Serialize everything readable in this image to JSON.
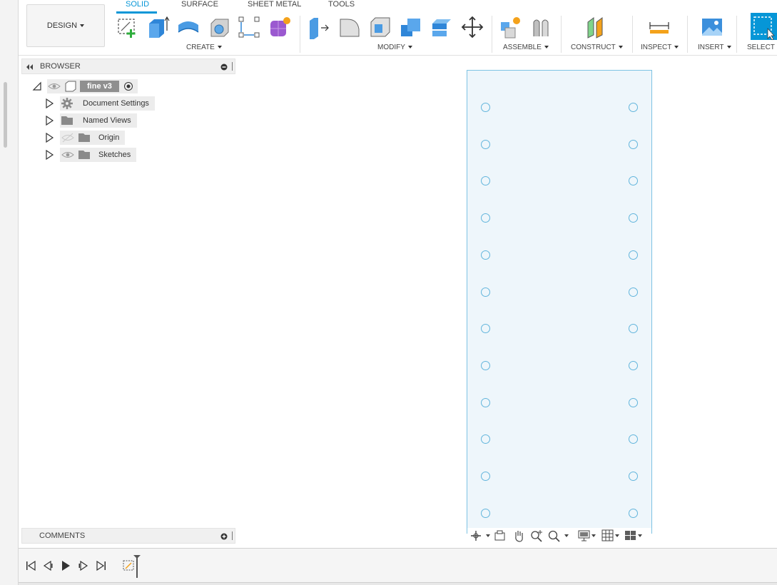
{
  "toolbar": {
    "workspace_label": "DESIGN",
    "tabs": [
      "SOLID",
      "SURFACE",
      "SHEET METAL",
      "TOOLS"
    ],
    "groups": {
      "create": "CREATE",
      "modify": "MODIFY",
      "assemble": "ASSEMBLE",
      "construct": "CONSTRUCT",
      "inspect": "INSPECT",
      "insert": "INSERT",
      "select": "SELECT"
    },
    "icons": {
      "create": [
        "create-sketch-icon",
        "extrude-icon",
        "revolve-icon",
        "hole-icon",
        "pattern-icon",
        "create-form-icon"
      ],
      "modify": [
        "press-pull-icon",
        "fillet-icon",
        "shell-icon",
        "combine-icon",
        "offset-face-icon",
        "move-icon"
      ],
      "assemble": [
        "new-component-icon",
        "joint-icon"
      ],
      "construct": [
        "offset-plane-icon"
      ],
      "inspect": [
        "measure-icon"
      ],
      "insert": [
        "insert-image-icon"
      ],
      "select": [
        "select-window-icon"
      ]
    },
    "accent_color": "#0696d7"
  },
  "browser": {
    "title": "BROWSER",
    "root": "fine v3",
    "items": [
      {
        "label": "Document Settings",
        "icon": "gear-icon"
      },
      {
        "label": "Named Views",
        "icon": "folder-icon"
      },
      {
        "label": "Origin",
        "icon": "folder-icon",
        "visibility": "hidden"
      },
      {
        "label": "Sketches",
        "icon": "folder-icon",
        "visibility": "visible"
      }
    ]
  },
  "comments": {
    "title": "COMMENTS"
  },
  "canvas": {
    "body_color": "#eef6fb",
    "edge_color": "#7ec3e3",
    "hole_rows": 12,
    "hole_columns": 2
  },
  "navbar": {
    "icons": [
      "orbit-icon",
      "look-at-icon",
      "pan-icon",
      "zoom-icon",
      "fit-icon",
      "display-settings-icon",
      "grid-icon",
      "viewports-icon"
    ]
  },
  "timeline": {
    "controls": [
      "go-to-start-icon",
      "step-back-icon",
      "play-icon",
      "step-forward-icon",
      "go-to-end-icon"
    ],
    "features": [
      "sketch-feature-icon"
    ]
  }
}
